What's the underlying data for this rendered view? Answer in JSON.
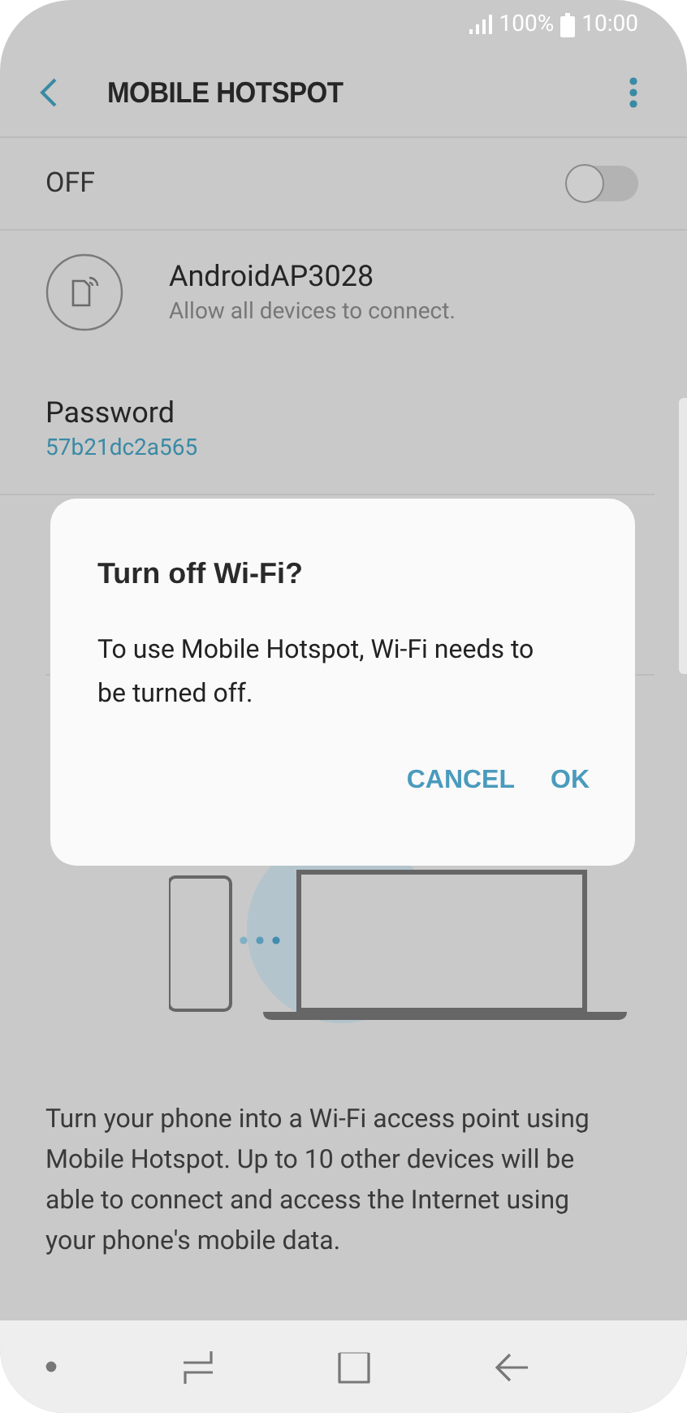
{
  "status_bar": {
    "battery": "100%",
    "time": "10:00"
  },
  "header": {
    "title": "MOBILE HOTSPOT"
  },
  "master_switch": {
    "label": "OFF",
    "on": false
  },
  "network": {
    "name": "AndroidAP3028",
    "subtitle": "Allow all devices to connect."
  },
  "password": {
    "label": "Password",
    "value": "57b21dc2a565"
  },
  "description": "Turn your phone into a Wi-Fi access point using Mobile Hotspot. Up to 10 other devices will be able to connect and access the Internet using your phone's mobile data.",
  "dialog": {
    "title": "Turn off Wi-Fi?",
    "message": "To use Mobile Hotspot, Wi-Fi needs to be turned off.",
    "buttons": [
      "CANCEL",
      "OK"
    ]
  }
}
